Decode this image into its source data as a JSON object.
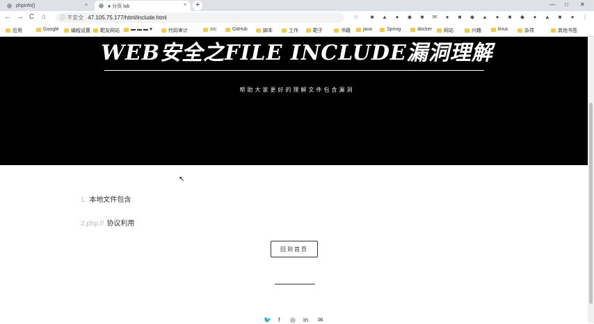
{
  "tabs": [
    {
      "label": "phpinfo()",
      "close": "×"
    },
    {
      "label": "● 分页 lab",
      "close": "×"
    }
  ],
  "new_tab": "+",
  "window_controls": {
    "minimize": "—",
    "maximize": "□",
    "close": "✕"
  },
  "toolbar": {
    "back": "←",
    "forward": "→",
    "reload": "C",
    "home": "⌂",
    "security": "ⓘ 不安全",
    "url": "47.105.75.177/html/include.html",
    "star": "☆"
  },
  "bookmarks": [
    "应用",
    "Google",
    "编程设置",
    "靶友网站",
    "▬ ▬ ▬ ♥",
    "代码审计",
    "src",
    "GitHub",
    "脚本",
    "工作",
    "靶子",
    "书籍",
    "java",
    "Spring",
    "docker",
    "网站",
    "兴趣",
    "linux",
    "杂项",
    "其他书签"
  ],
  "hero": {
    "title": "WEB安全之FILE INCLUDE漏洞理解",
    "subtitle": "帮助大家更好的理解文件包含漏洞"
  },
  "links": [
    {
      "prefix": "1.",
      "label": "本地文件包含"
    },
    {
      "prefix": "2.php://",
      "label": "协议利用"
    }
  ],
  "home_button": "回到首页",
  "social": {
    "twitter": "🐦",
    "facebook": "f",
    "instagram": "◎",
    "linkedin": "in",
    "email": "✉"
  }
}
